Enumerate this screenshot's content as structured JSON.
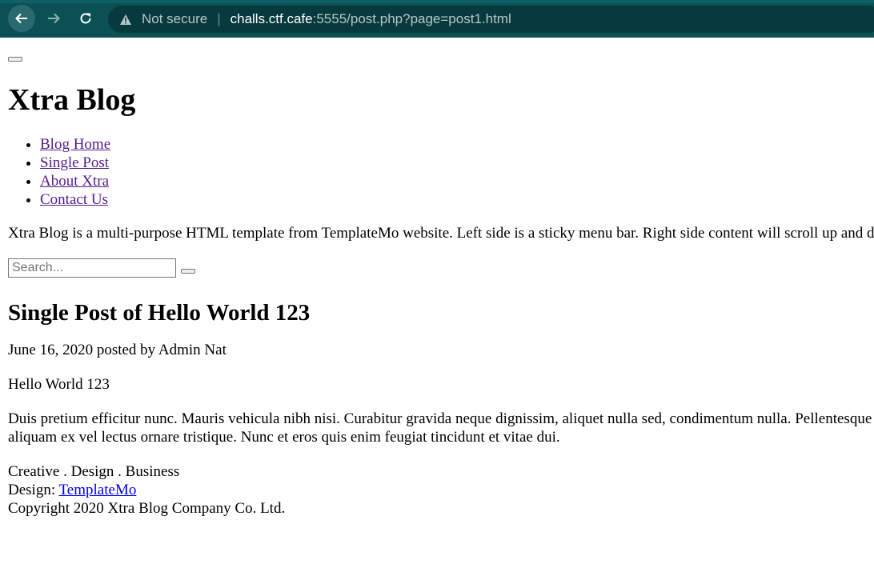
{
  "browser": {
    "security_label": "Not secure",
    "url_host": "challs.ctf.cafe",
    "url_rest": ":5555/post.php?page=post1.html",
    "icons": [
      "back-arrow-icon",
      "forward-arrow-icon",
      "reload-icon",
      "warning-icon"
    ]
  },
  "site": {
    "title": "Xtra Blog",
    "nav": [
      {
        "label": "Blog Home"
      },
      {
        "label": "Single Post"
      },
      {
        "label": "About Xtra"
      },
      {
        "label": "Contact Us"
      }
    ],
    "intro": "Xtra Blog is a multi-purpose HTML template from TemplateMo website. Left side is a sticky menu bar. Right side content will scroll up and down."
  },
  "search": {
    "placeholder": "Search..."
  },
  "post": {
    "title": "Single Post of Hello World 123",
    "meta": "June 16, 2020 posted by Admin Nat",
    "subtitle": "Hello World 123",
    "body_line1": "Duis pretium efficitur nunc. Mauris vehicula nibh nisi. Curabitur gravida neque dignissim, aliquet nulla sed, condimentum nulla. Pellentesque",
    "body_line2": "aliquam ex vel lectus ornare tristique. Nunc et eros quis enim feugiat tincidunt et vitae dui."
  },
  "footer": {
    "tagline": "Creative . Design . Business",
    "design_prefix": "Design:",
    "design_link": "TemplateMo",
    "copyright": "Copyright 2020 Xtra Blog Company Co. Ltd."
  }
}
